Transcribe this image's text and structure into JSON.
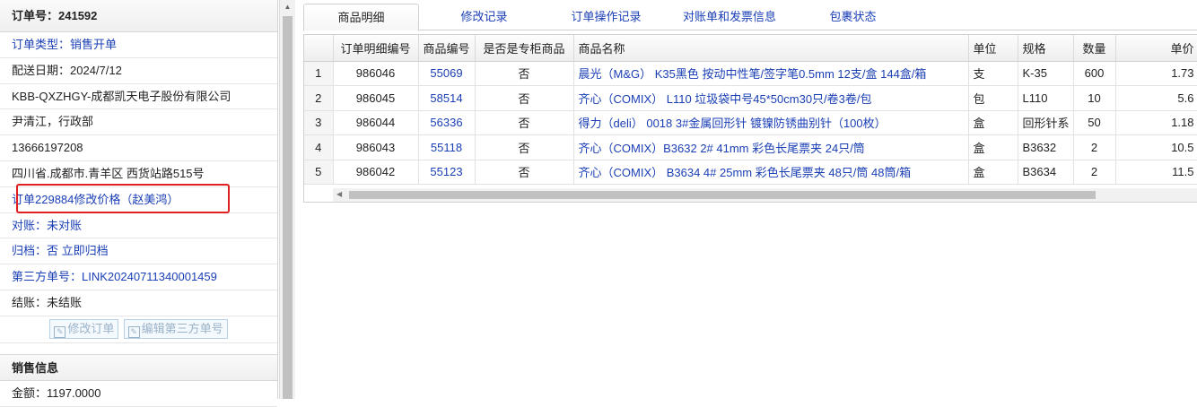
{
  "order_panel": {
    "title": "订单号：241592",
    "type": "订单类型：销售开单",
    "date": "配送日期：2024/7/12",
    "customer": "KBB-QXZHGY-成都凯天电子股份有限公司",
    "contact": "尹清江，行政部",
    "phone": "13666197208",
    "address": "四川省.成都市.青羊区 西货站路515号",
    "change_note": "订单229884修改价格（赵美鸿）",
    "reconcile_label": "对账：",
    "reconcile_value": "未对账",
    "archive_label": "归档：",
    "archive_value": "否 立即归档",
    "third_party_label": "第三方单号：",
    "third_party_value": "LINK20240711340001459",
    "settle": "结账：未结账",
    "edit_order_button": "修改订单",
    "edit_third_party_button": "编辑第三方单号"
  },
  "sales_panel": {
    "title": "销售信息",
    "amount": "金额：1197.0000"
  },
  "tabs": [
    "商品明细",
    "修改记录",
    "订单操作记录",
    "对账单和发票信息",
    "包裹状态"
  ],
  "table": {
    "headers": [
      "",
      "订单明细编号",
      "商品编号",
      "是否是专柜商品",
      "商品名称",
      "单位",
      "规格",
      "数量",
      "单价"
    ],
    "rows": [
      [
        "1",
        "986046",
        "55069",
        "否",
        "晨光（M&G） K35黑色 按动中性笔/签字笔0.5mm 12支/盒 144盒/箱",
        "支",
        "K-35",
        "600",
        "1.73"
      ],
      [
        "2",
        "986045",
        "58514",
        "否",
        "齐心（COMIX） L110 垃圾袋中号45*50cm30只/卷3卷/包",
        "包",
        "L110",
        "10",
        "5.6"
      ],
      [
        "3",
        "986044",
        "56336",
        "否",
        "得力（deli） 0018 3#金属回形针 镀镍防锈曲别针（100枚）",
        "盒",
        "回形针系",
        "50",
        "1.18"
      ],
      [
        "4",
        "986043",
        "55118",
        "否",
        "齐心（COMIX）B3632 2# 41mm 彩色长尾票夹 24只/筒",
        "盒",
        "B3632",
        "2",
        "10.5"
      ],
      [
        "5",
        "986042",
        "55123",
        "否",
        "齐心（COMIX） B3634 4# 25mm 彩色长尾票夹 48只/筒 48筒/箱",
        "盒",
        "B3634",
        "2",
        "11.5"
      ]
    ]
  },
  "icons": {
    "edit": "edit-icon",
    "scroll_up": "scroll-up-arrow-icon",
    "scroll_left": "scroll-left-arrow-icon"
  },
  "colors": {
    "link": "#1a3fb5",
    "highlight_border": "#e02020"
  }
}
